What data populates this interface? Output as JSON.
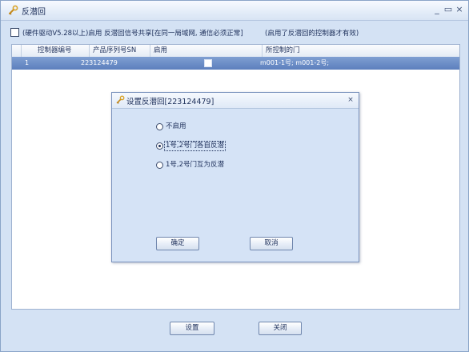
{
  "window": {
    "title": "反潜回",
    "min_glyph": "_",
    "max_glyph": "▭",
    "close_glyph": "×"
  },
  "option": {
    "label": "(硬件驱动V5.28以上)启用 反潜回信号共享[在同一局域网, 通信必须正常]",
    "note": "(启用了反潜回的控制器才有效)",
    "checked": false
  },
  "grid": {
    "columns": [
      "控制器编号",
      "产品序列号SN",
      "启用",
      "所控制的门"
    ],
    "rows": [
      {
        "id": "1",
        "sn": "223124479",
        "enabled": false,
        "doors": "m001-1号;    m001-2号;"
      }
    ]
  },
  "buttons": {
    "setup": "设置",
    "close": "关闭"
  },
  "dialog": {
    "title": "设置反潜回[223124479]",
    "close_glyph": "×",
    "options": [
      {
        "label": "不启用",
        "checked": false
      },
      {
        "label": "1号,2号门各自反潜",
        "checked": true
      },
      {
        "label": "1号,2号门互为反潜",
        "checked": false
      }
    ],
    "ok": "确定",
    "cancel": "取消"
  },
  "colors": {
    "selected_row": "#6a8cc7",
    "panel_bg": "#d4e2f4",
    "dialog_bg": "#d5e3f6"
  },
  "icons": {
    "app": "key-icon",
    "dialog": "key-icon"
  }
}
